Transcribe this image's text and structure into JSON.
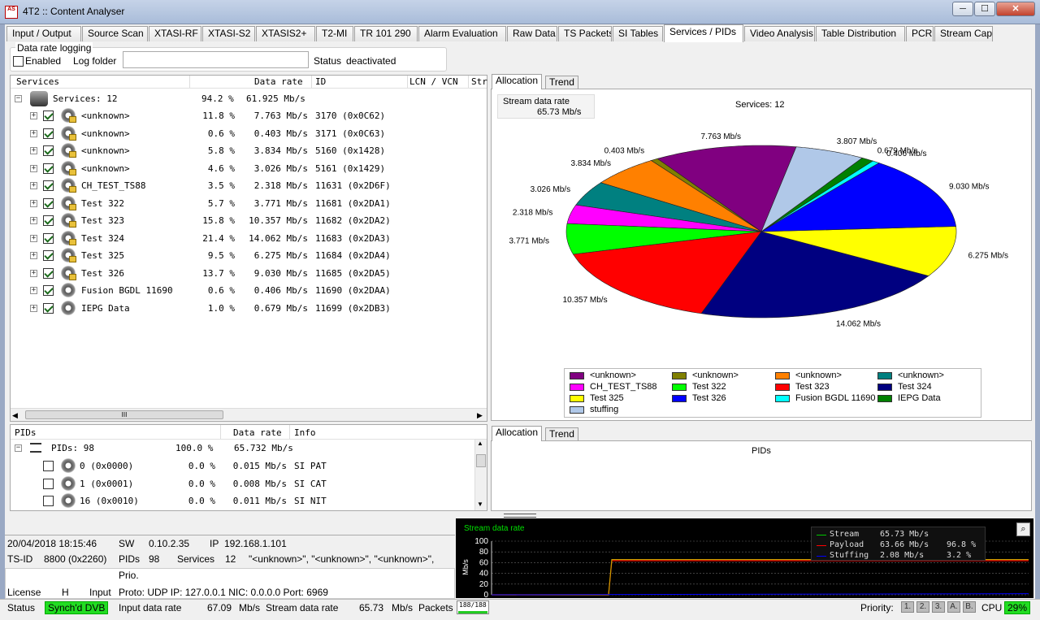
{
  "window": {
    "app_icon_text": "AS",
    "title": "4T2 :: Content Analyser",
    "min": "─",
    "max": "☐",
    "close": "✕"
  },
  "tabs": [
    "Input / Output",
    "Source Scan",
    "XTASI-RF",
    "XTASI-S2",
    "XTASIS2+",
    "T2-MI",
    "TR 101 290",
    "Alarm Evaluation",
    "Raw Data",
    "TS Packets",
    "SI Tables",
    "Services / PIDs",
    "Video Analysis",
    "Table Distribution",
    "PCR",
    "Stream Capt"
  ],
  "active_tab": "Services / PIDs",
  "logging": {
    "group_label": "Data rate logging",
    "enabled_label": "Enabled",
    "log_folder_label": "Log folder",
    "log_folder_value": "",
    "status_label": "Status",
    "status_value": "deactivated"
  },
  "services": {
    "headers": {
      "services": "Services",
      "data_rate": "Data rate",
      "id": "ID",
      "lcn": "LCN / VCN",
      "str": "Str"
    },
    "root": {
      "label": "Services: 12",
      "pct": "94.2 %",
      "rate": "61.925 Mb/s"
    },
    "rows": [
      {
        "name": "<unknown>",
        "pct": "11.8 %",
        "rate": "7.763 Mb/s",
        "id": "3170 (0x0C62)"
      },
      {
        "name": "<unknown>",
        "pct": "0.6 %",
        "rate": "0.403 Mb/s",
        "id": "3171 (0x0C63)"
      },
      {
        "name": "<unknown>",
        "pct": "5.8 %",
        "rate": "3.834 Mb/s",
        "id": "5160 (0x1428)"
      },
      {
        "name": "<unknown>",
        "pct": "4.6 %",
        "rate": "3.026 Mb/s",
        "id": "5161 (0x1429)"
      },
      {
        "name": "CH_TEST_TS88",
        "pct": "3.5 %",
        "rate": "2.318 Mb/s",
        "id": "11631 (0x2D6F)"
      },
      {
        "name": "Test 322",
        "pct": "5.7 %",
        "rate": "3.771 Mb/s",
        "id": "11681 (0x2DA1)"
      },
      {
        "name": "Test 323",
        "pct": "15.8 %",
        "rate": "10.357 Mb/s",
        "id": "11682 (0x2DA2)"
      },
      {
        "name": "Test 324",
        "pct": "21.4 %",
        "rate": "14.062 Mb/s",
        "id": "11683 (0x2DA3)"
      },
      {
        "name": "Test 325",
        "pct": "9.5 %",
        "rate": "6.275 Mb/s",
        "id": "11684 (0x2DA4)"
      },
      {
        "name": "Test 326",
        "pct": "13.7 %",
        "rate": "9.030 Mb/s",
        "id": "11685 (0x2DA5)"
      },
      {
        "name": "Fusion BGDL 11690",
        "pct": "0.6 %",
        "rate": "0.406 Mb/s",
        "id": "11690 (0x2DAA)"
      },
      {
        "name": "IEPG Data",
        "pct": "1.0 %",
        "rate": "0.679 Mb/s",
        "id": "11699 (0x2DB3)"
      }
    ],
    "scroll_grip": "III"
  },
  "allocation": {
    "tab_allocation": "Allocation",
    "tab_trend": "Trend",
    "stream_rate_label": "Stream data rate",
    "stream_rate_value": "65.73 Mb/s",
    "chart_title": "Services: 12"
  },
  "chart_data": {
    "type": "pie",
    "title": "Services: 12",
    "slices": [
      {
        "label": "<unknown>",
        "value": 7.763,
        "text": "7.763 Mb/s",
        "color": "#800080"
      },
      {
        "label": "<unknown>",
        "value": 0.403,
        "text": "0.403 Mb/s",
        "color": "#808000"
      },
      {
        "label": "<unknown>",
        "value": 3.834,
        "text": "3.834 Mb/s",
        "color": "#ff8000"
      },
      {
        "label": "<unknown>",
        "value": 3.026,
        "text": "3.026 Mb/s",
        "color": "#008080"
      },
      {
        "label": "CH_TEST_TS88",
        "value": 2.318,
        "text": "2.318 Mb/s",
        "color": "#ff00ff"
      },
      {
        "label": "Test 322",
        "value": 3.771,
        "text": "3.771 Mb/s",
        "color": "#00ff00"
      },
      {
        "label": "Test 323",
        "value": 10.357,
        "text": "10.357 Mb/s",
        "color": "#ff0000"
      },
      {
        "label": "Test 324",
        "value": 14.062,
        "text": "14.062 Mb/s",
        "color": "#000080"
      },
      {
        "label": "Test 325",
        "value": 6.275,
        "text": "6.275 Mb/s",
        "color": "#ffff00"
      },
      {
        "label": "Test 326",
        "value": 9.03,
        "text": "9.030 Mb/s",
        "color": "#0000ff"
      },
      {
        "label": "Fusion BGDL 11690",
        "value": 0.406,
        "text": "0.406 Mb/s",
        "color": "#00ffff"
      },
      {
        "label": "IEPG Data",
        "value": 0.679,
        "text": "0.679 Mb/s",
        "color": "#008000"
      },
      {
        "label": "stuffing",
        "value": 3.807,
        "text": "3.807 Mb/s",
        "color": "#b0c8e8"
      }
    ],
    "legend_placement": "bottom"
  },
  "pids": {
    "headers": {
      "pids": "PIDs",
      "data_rate": "Data rate",
      "info": "Info"
    },
    "root": {
      "label": "PIDs: 98",
      "pct": "100.0 %",
      "rate": "65.732 Mb/s"
    },
    "rows": [
      {
        "pid": "0 (0x0000)",
        "pct": "0.0 %",
        "rate": "0.015 Mb/s",
        "info": "SI PAT"
      },
      {
        "pid": "1 (0x0001)",
        "pct": "0.0 %",
        "rate": "0.008 Mb/s",
        "info": "SI CAT"
      },
      {
        "pid": "16 (0x0010)",
        "pct": "0.0 %",
        "rate": "0.011 Mb/s",
        "info": "SI NIT"
      }
    ],
    "tab_allocation": "Allocation",
    "tab_trend": "Trend",
    "chart_title": "PIDs"
  },
  "info": {
    "datetime": "20/04/2018 18:15:46",
    "sw_label": "SW",
    "sw_value": "0.10.2.35",
    "ip_label": "IP",
    "ip_value": "192.168.1.101",
    "tsid_label": "TS-ID",
    "tsid_value": "8800 (0x2260)",
    "pids_label": "PIDs",
    "pids_value": "98",
    "services_label": "Services",
    "services_value": "12",
    "services_names": "\"<unknown>\", \"<unknown>\", \"<unknown>\",",
    "prio": "Prio.",
    "license_label": "License",
    "license_value": "H",
    "input_label": "Input",
    "input_value": "Proto: UDP IP: 127.0.0.1 NIC: 0.0.0.0 Port: 6969"
  },
  "trend_chart": {
    "title": "Stream data rate",
    "ylabel": "Mb/s",
    "yticks": [
      "100",
      "80",
      "60",
      "40",
      "20",
      "0"
    ],
    "legend": [
      {
        "name": "Stream",
        "value": "65.73 Mb/s",
        "pct": "",
        "color": "#00c800"
      },
      {
        "name": "Payload",
        "value": "63.66 Mb/s",
        "pct": "96.8 %",
        "color": "#ff0000"
      },
      {
        "name": "Stuffing",
        "value": "2.08 Mb/s",
        "pct": "3.2 %",
        "color": "#0000ff"
      }
    ]
  },
  "status": {
    "status_label": "Status",
    "status_value": "Synch'd DVB",
    "input_rate_label": "Input data rate",
    "input_rate_value": "67.09",
    "input_rate_unit": "Mb/s",
    "stream_rate_label": "Stream data rate",
    "stream_rate_value": "65.73",
    "stream_rate_unit": "Mb/s",
    "packets_label": "Packets",
    "packets_value": "188/188",
    "priority_label": "Priority:",
    "priority_buttons": [
      "1.",
      "2.",
      "3.",
      "A.",
      "B."
    ],
    "cpu_label": "CPU",
    "cpu_value": "29%"
  }
}
